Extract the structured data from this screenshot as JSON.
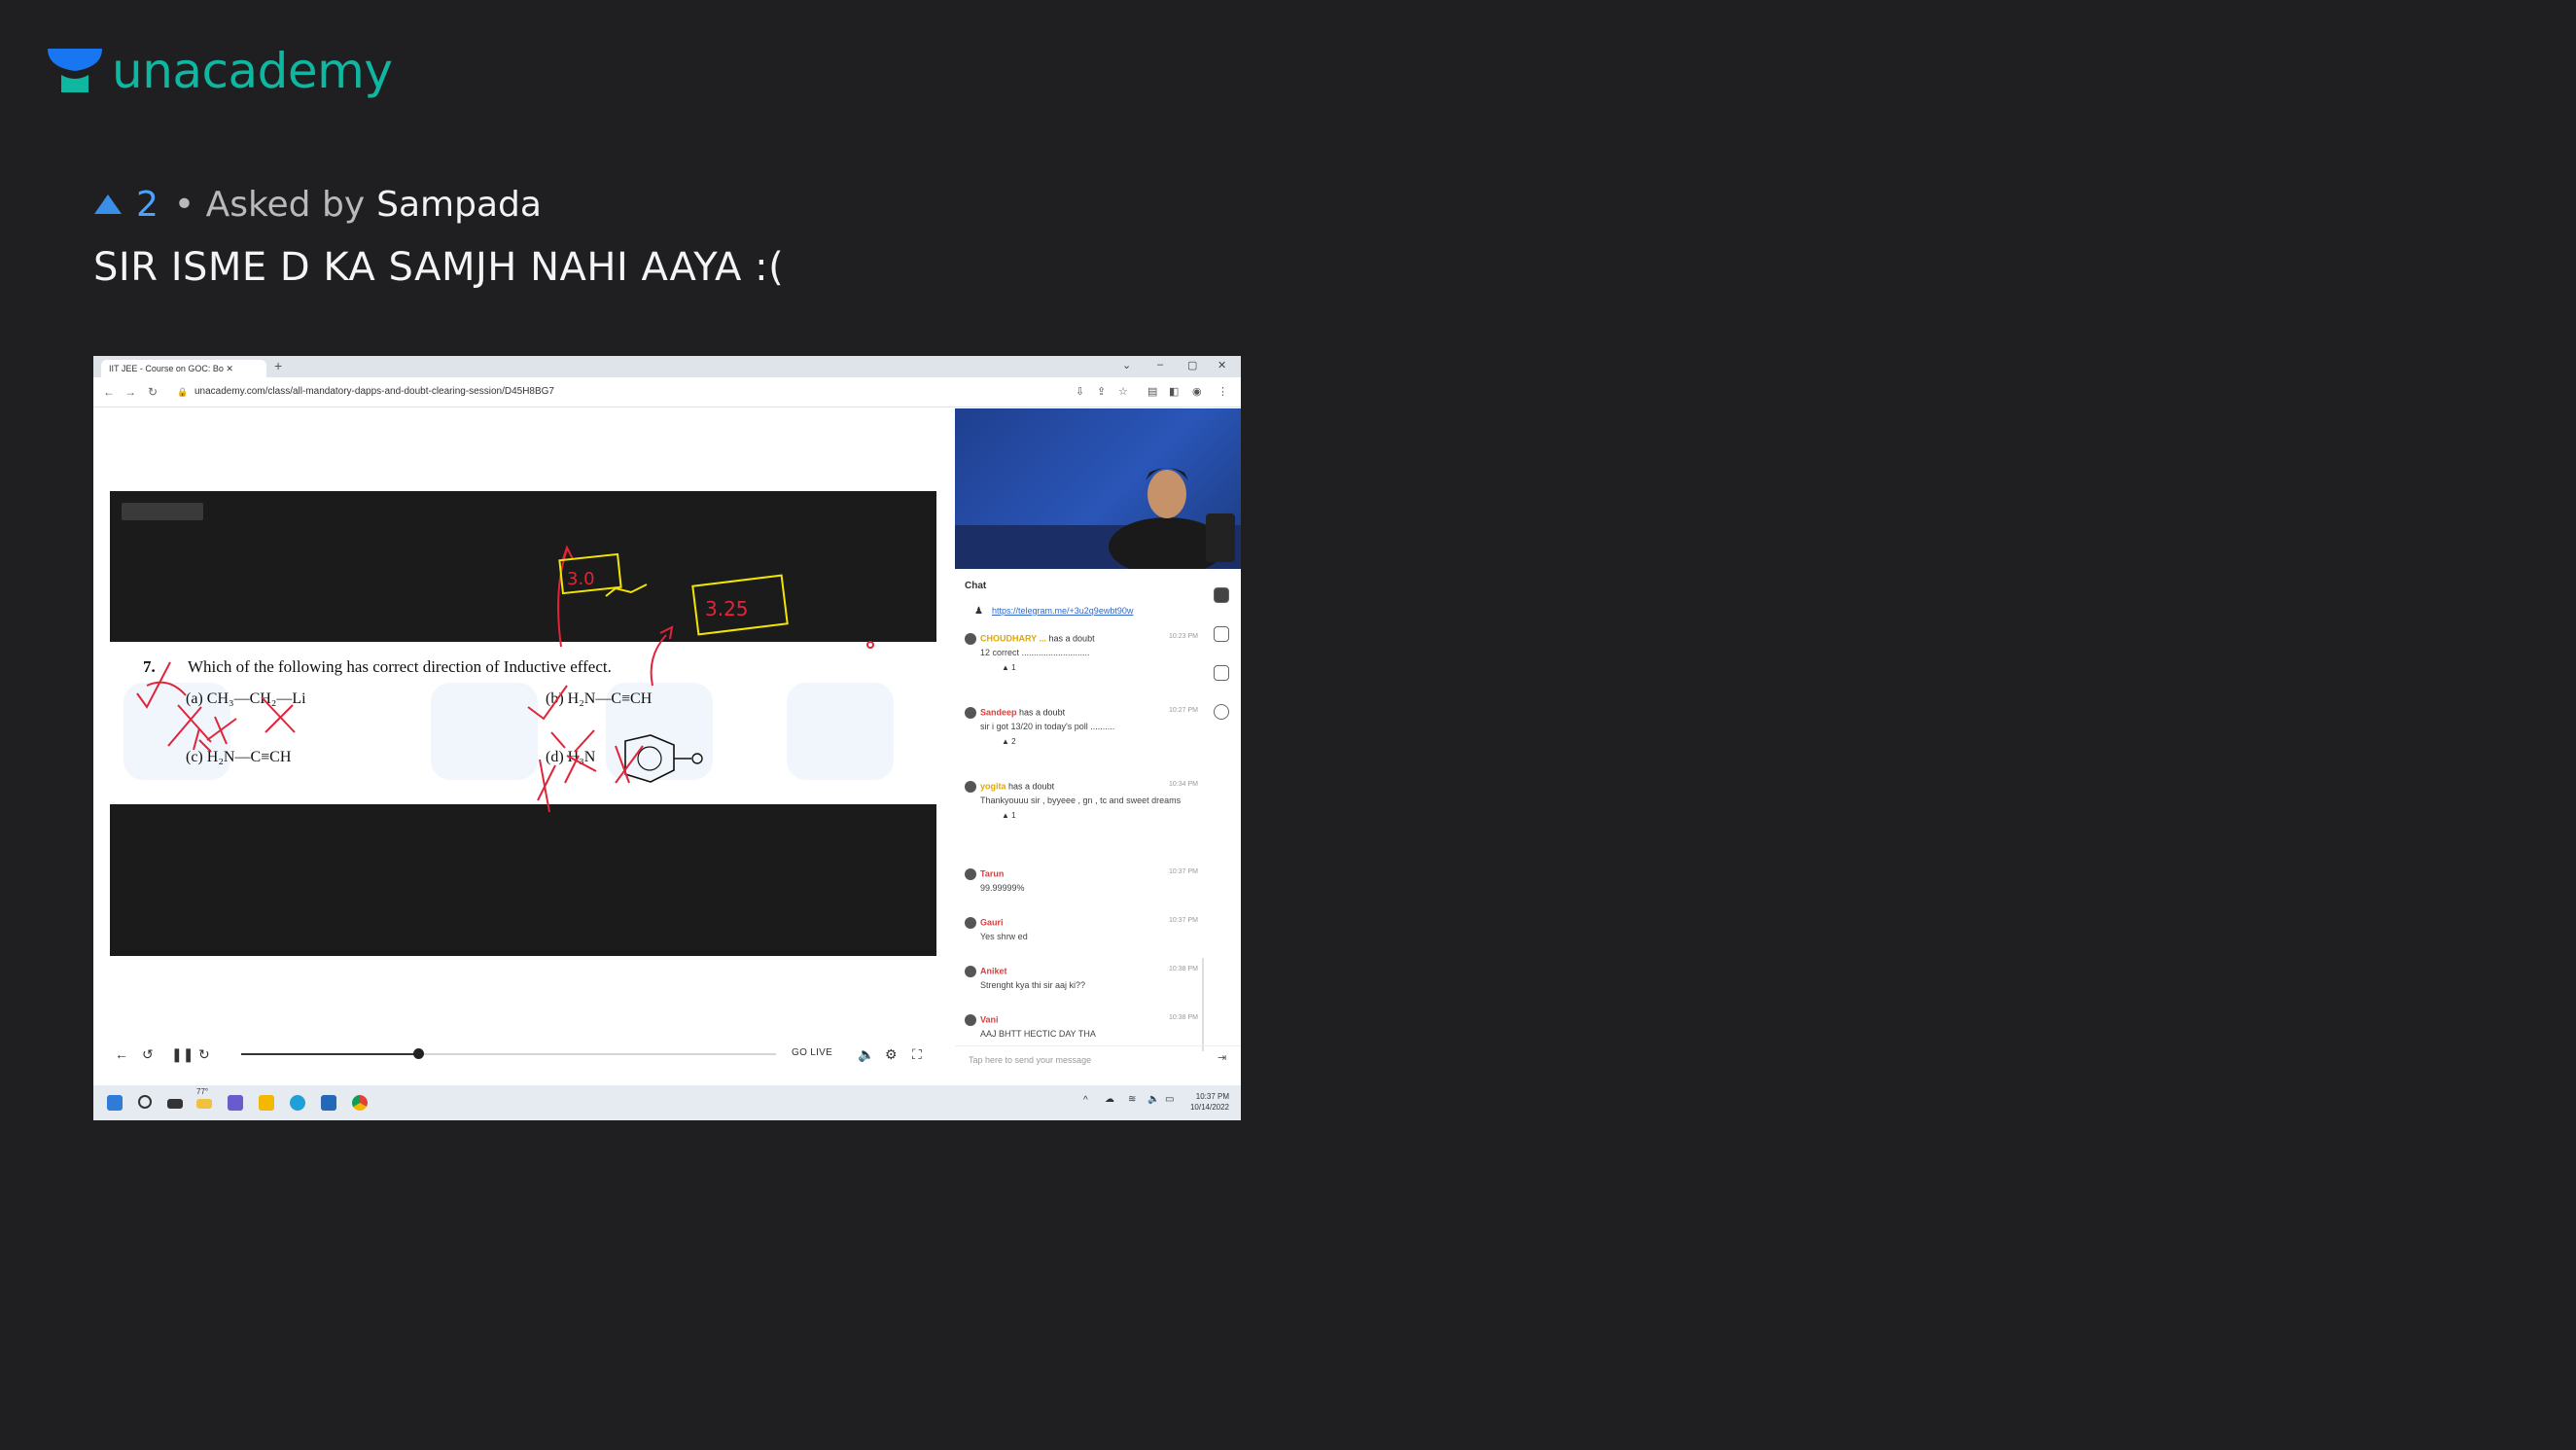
{
  "brand": {
    "name": "unacademy",
    "logo_color": "#0fb7a0"
  },
  "question_meta": {
    "upvote_icon": "triangle-up-icon",
    "votes": "2",
    "asked_by_label": "• Asked by",
    "author": "Sampada"
  },
  "question": {
    "title": "SIR ISME D KA SAMJH NAHI AAYA :("
  },
  "screenshot": {
    "browser": {
      "tab_title": "IIT JEE - Course on GOC: Bo",
      "url": "unacademy.com/class/all-mandatory-dapps-and-doubt-clearing-session/D45H8BG7"
    },
    "problem": {
      "number": "7.",
      "statement": "Which of the following has correct direction of Inductive effect.",
      "options": [
        {
          "label": "(a)",
          "text": "CH₃—CH₂—Li"
        },
        {
          "label": "(b)",
          "text": "H₂N—C≡CH"
        },
        {
          "label": "(c)",
          "text": "H₂N—C≡CH"
        },
        {
          "label": "(d)",
          "text": "H₃N"
        }
      ],
      "annotations": [
        "3.0",
        "3.25"
      ]
    },
    "player": {
      "go_live": "GO LIVE",
      "progress": 0.33
    },
    "chat": {
      "title": "Chat",
      "pinned_link": "https://telegram.me/+3u2q9ewbt90w",
      "messages": [
        {
          "user": "CHOUDHARY ...",
          "action": "has a doubt",
          "time": "10:23 PM",
          "text": "12 correct ............................",
          "votes": "▲ 1"
        },
        {
          "user": "Sandeep",
          "action": "has a doubt",
          "time": "10:27 PM",
          "text": "sir i got 13/20 in today's poll ..........",
          "votes": "▲ 2"
        },
        {
          "user": "yogita",
          "action": "has a doubt",
          "time": "10:34 PM",
          "text": "Thankyouuu sir , byyeee , gn , tc and sweet dreams",
          "votes": "▲ 1"
        },
        {
          "user": "Tarun",
          "action": "",
          "time": "10:37 PM",
          "text": "99.99999%",
          "votes": ""
        },
        {
          "user": "Gauri",
          "action": "",
          "time": "10:37 PM",
          "text": "Yes shrw ed",
          "votes": ""
        },
        {
          "user": "Aniket",
          "action": "",
          "time": "10:38 PM",
          "text": "Strenght kya thi sir aaj ki??",
          "votes": ""
        },
        {
          "user": "Vani",
          "action": "",
          "time": "10:38 PM",
          "text": "AAJ BHTT HECTIC DAY THA",
          "votes": ""
        }
      ],
      "input_placeholder": "Tap here to send your message"
    },
    "taskbar": {
      "weather": "77°",
      "clock_time": "10:37 PM",
      "clock_date": "10/14/2022"
    }
  }
}
